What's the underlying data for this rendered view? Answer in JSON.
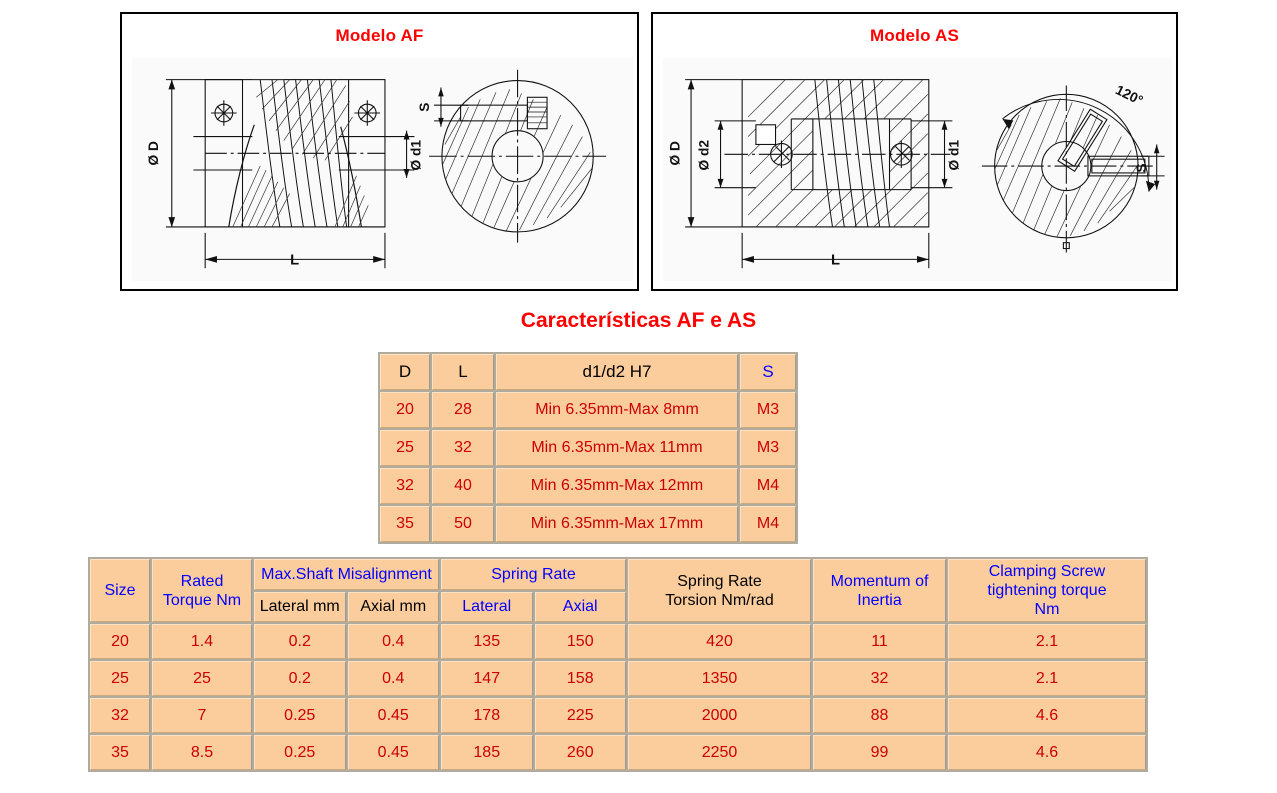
{
  "diagrams": [
    {
      "title": "Modelo AF",
      "labels": {
        "outer_diameter": "Ø D",
        "bore1": "Ø d1",
        "screw": "S",
        "length": "L"
      }
    },
    {
      "title": "Modelo AS",
      "labels": {
        "outer_diameter": "Ø D",
        "bore2": "Ø d2",
        "bore1": "Ø d1",
        "screw": "S",
        "length": "L",
        "angle": "120°"
      }
    }
  ],
  "section_heading": "Características AF e AS",
  "dim_table": {
    "headers": [
      "D",
      "L",
      "d1/d2 H7",
      "S"
    ],
    "rows": [
      [
        "20",
        "28",
        "Min 6.35mm-Max 8mm",
        "M3"
      ],
      [
        "25",
        "32",
        "Min 6.35mm-Max 11mm",
        "M3"
      ],
      [
        "32",
        "40",
        "Min 6.35mm-Max 12mm",
        "M4"
      ],
      [
        "35",
        "50",
        "Min 6.35mm-Max 17mm",
        "M4"
      ]
    ]
  },
  "spec_table": {
    "headers": {
      "size": "Size",
      "rated_torque": "Rated\nTorque Nm",
      "misalignment_group": "Max.Shaft Misalignment",
      "misalignment_lateral": "Lateral mm",
      "misalignment_axial": "Axial mm",
      "spring_rate_group": "Spring Rate",
      "spring_rate_lateral": "Lateral",
      "spring_rate_axial": "Axial",
      "spring_rate_torsion": "Spring Rate\nTorsion Nm/rad",
      "momentum_inertia": "Momentum of\nInertia",
      "clamping_screw": "Clamping Screw\ntightening torque\nNm"
    },
    "rows": [
      {
        "size": "20",
        "rated_torque": "1.4",
        "mis_lateral": "0.2",
        "mis_axial": "0.4",
        "sr_lateral": "135",
        "sr_axial": "150",
        "sr_torsion": "420",
        "inertia": "11",
        "clamping": "2.1"
      },
      {
        "size": "25",
        "rated_torque": "25",
        "mis_lateral": "0.2",
        "mis_axial": "0.4",
        "sr_lateral": "147",
        "sr_axial": "158",
        "sr_torsion": "1350",
        "inertia": "32",
        "clamping": "2.1"
      },
      {
        "size": "32",
        "rated_torque": "7",
        "mis_lateral": "0.25",
        "mis_axial": "0.45",
        "sr_lateral": "178",
        "sr_axial": "225",
        "sr_torsion": "2000",
        "inertia": "88",
        "clamping": "4.6"
      },
      {
        "size": "35",
        "rated_torque": "8.5",
        "mis_lateral": "0.25",
        "mis_axial": "0.45",
        "sr_lateral": "185",
        "sr_axial": "260",
        "sr_torsion": "2250",
        "inertia": "99",
        "clamping": "4.6"
      }
    ]
  },
  "colors": {
    "heading_red": "#ff0000",
    "value_red": "#cc0000",
    "header_blue": "#0000ff",
    "table_fill": "#fbcd9d",
    "table_grid": "#b0ab9c",
    "page_background": "#ffffff"
  }
}
